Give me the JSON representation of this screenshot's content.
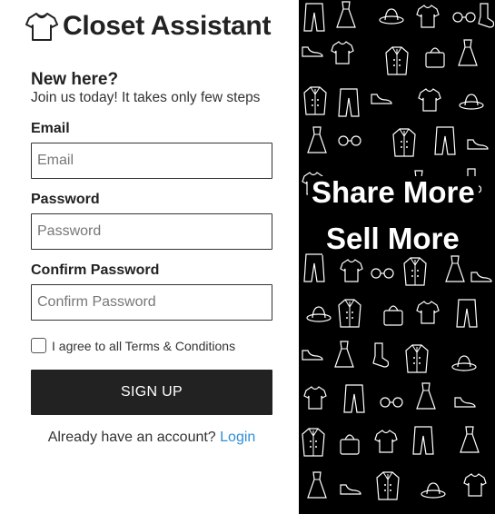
{
  "brand": {
    "name": "Closet Assistant",
    "icon": "tshirt-icon"
  },
  "signup_form": {
    "heading": "New here?",
    "subheading": "Join us today! It takes only few steps",
    "email": {
      "label": "Email",
      "placeholder": "Email",
      "value": ""
    },
    "password": {
      "label": "Password",
      "placeholder": "Password",
      "value": ""
    },
    "confirm_password": {
      "label": "Confirm Password",
      "placeholder": "Confirm Password",
      "value": ""
    },
    "terms": {
      "label": "I agree to all Terms & Conditions",
      "checked": false
    },
    "submit_label": "SIGN UP",
    "login_prompt": "Already have an account?",
    "login_link": "Login"
  },
  "promo": {
    "line1": "Share More",
    "line2": "Sell More",
    "background": "clothing-doodle-pattern"
  },
  "colors": {
    "primary_button": "#222222",
    "link": "#2f8fd6",
    "promo_background": "#000000"
  }
}
